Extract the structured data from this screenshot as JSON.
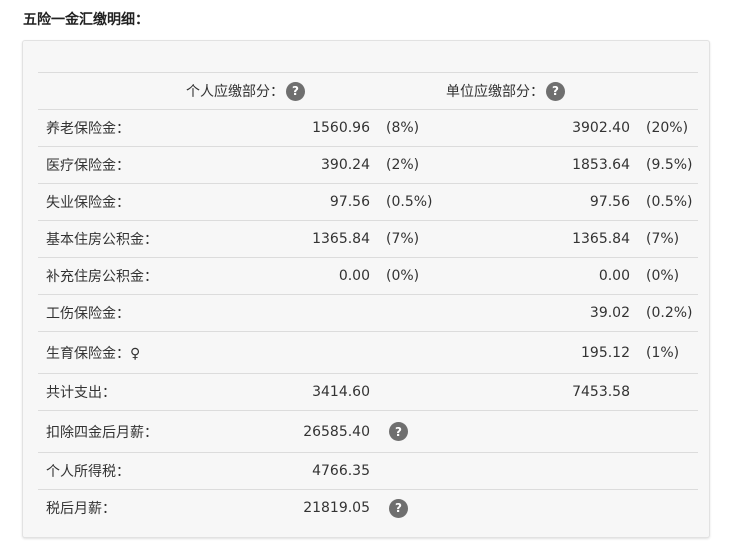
{
  "title": "五险一金汇缴明细：",
  "header": {
    "personal": "个人应缴部分：",
    "company": "单位应缴部分：",
    "help_glyph": "?"
  },
  "items": [
    {
      "label": "养老保险金：",
      "personal_value": "1560.96",
      "personal_rate": "(8%)",
      "company_value": "3902.40",
      "company_rate": "(20%)"
    },
    {
      "label": "医疗保险金：",
      "personal_value": "390.24",
      "personal_rate": "(2%)",
      "company_value": "1853.64",
      "company_rate": "(9.5%)"
    },
    {
      "label": "失业保险金：",
      "personal_value": "97.56",
      "personal_rate": "(0.5%)",
      "company_value": "97.56",
      "company_rate": "(0.5%)"
    },
    {
      "label": "基本住房公积金：",
      "personal_value": "1365.84",
      "personal_rate": "(7%)",
      "company_value": "1365.84",
      "company_rate": "(7%)"
    },
    {
      "label": "补充住房公积金：",
      "personal_value": "0.00",
      "personal_rate": "(0%)",
      "company_value": "0.00",
      "company_rate": "(0%)"
    },
    {
      "label": "工伤保险金：",
      "personal_value": "",
      "personal_rate": "",
      "company_value": "39.02",
      "company_rate": "(0.2%)"
    },
    {
      "label": "生育保险金：♀",
      "personal_value": "",
      "personal_rate": "",
      "company_value": "195.12",
      "company_rate": "(1%)"
    }
  ],
  "totals": {
    "label": "共计支出：",
    "personal_value": "3414.60",
    "company_value": "7453.58"
  },
  "after_deduction": {
    "label": "扣除四金后月薪：",
    "value": "26585.40"
  },
  "income_tax": {
    "label": "个人所得税：",
    "value": "4766.35"
  },
  "net_salary": {
    "label": "税后月薪：",
    "value": "21819.05"
  }
}
